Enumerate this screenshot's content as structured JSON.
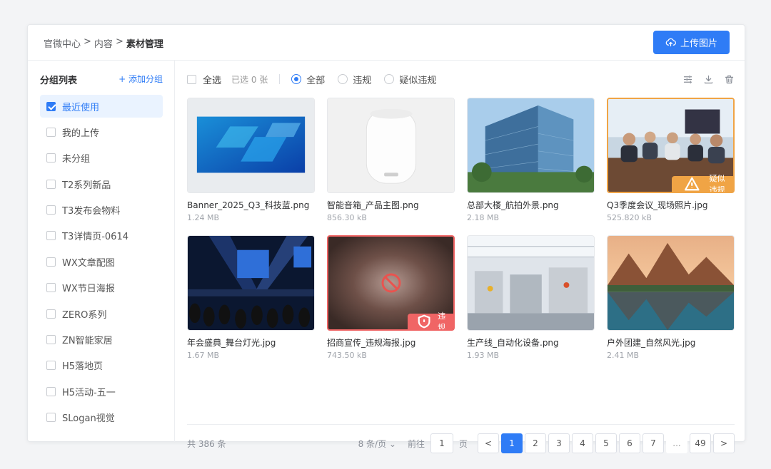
{
  "breadcrumb": [
    "官微中心",
    "内容",
    "素材管理"
  ],
  "header": {
    "upload_label": "上传图片"
  },
  "sidebar": {
    "title": "分组列表",
    "add_label": "+ 添加分组",
    "items": [
      {
        "label": "最近使用",
        "checked": true
      },
      {
        "label": "我的上传"
      },
      {
        "label": "未分组"
      },
      {
        "label": "T2系列新品"
      },
      {
        "label": "T3发布会物料"
      },
      {
        "label": "T3详情页-0614"
      },
      {
        "label": "WX文章配图"
      },
      {
        "label": "WX节日海报"
      },
      {
        "label": "ZERO系列"
      },
      {
        "label": "ZN智能家居"
      },
      {
        "label": "H5落地页"
      },
      {
        "label": "H5活动-五一"
      },
      {
        "label": "SLogan视觉"
      }
    ]
  },
  "toolbar": {
    "select_all": "全选",
    "selected_count": "已选 0 张",
    "filters": [
      "全部",
      "违规",
      "疑似违规"
    ]
  },
  "files": [
    {
      "name": "Banner_2025_Q3_科技蓝.png",
      "size": "1.24 MB"
    },
    {
      "name": "智能音箱_产品主图.png",
      "size": "856.30 kB"
    },
    {
      "name": "总部大楼_航拍外景.png",
      "size": "2.18 MB"
    },
    {
      "name": "Q3季度会议_现场照片.jpg",
      "size": "525.820 kB",
      "badge": "疑似违规"
    },
    {
      "name": "年会盛典_舞台灯光.jpg",
      "size": "1.67 MB"
    },
    {
      "name": "招商宣传_违规海报.jpg",
      "size": "743.50 kB",
      "badge": "违规"
    },
    {
      "name": "生产线_自动化设备.png",
      "size": "1.93 MB"
    },
    {
      "name": "户外团建_自然风光.jpg",
      "size": "2.41 MB"
    }
  ],
  "pagination": {
    "total": "共 386 条",
    "page_size": "8 条/页",
    "goto_prefix": "前往",
    "goto_value": "1",
    "goto_suffix": "页",
    "prev": "<",
    "next": ">",
    "pages": [
      "1",
      "2",
      "3",
      "4",
      "5",
      "6",
      "7",
      "...",
      "49"
    ]
  }
}
